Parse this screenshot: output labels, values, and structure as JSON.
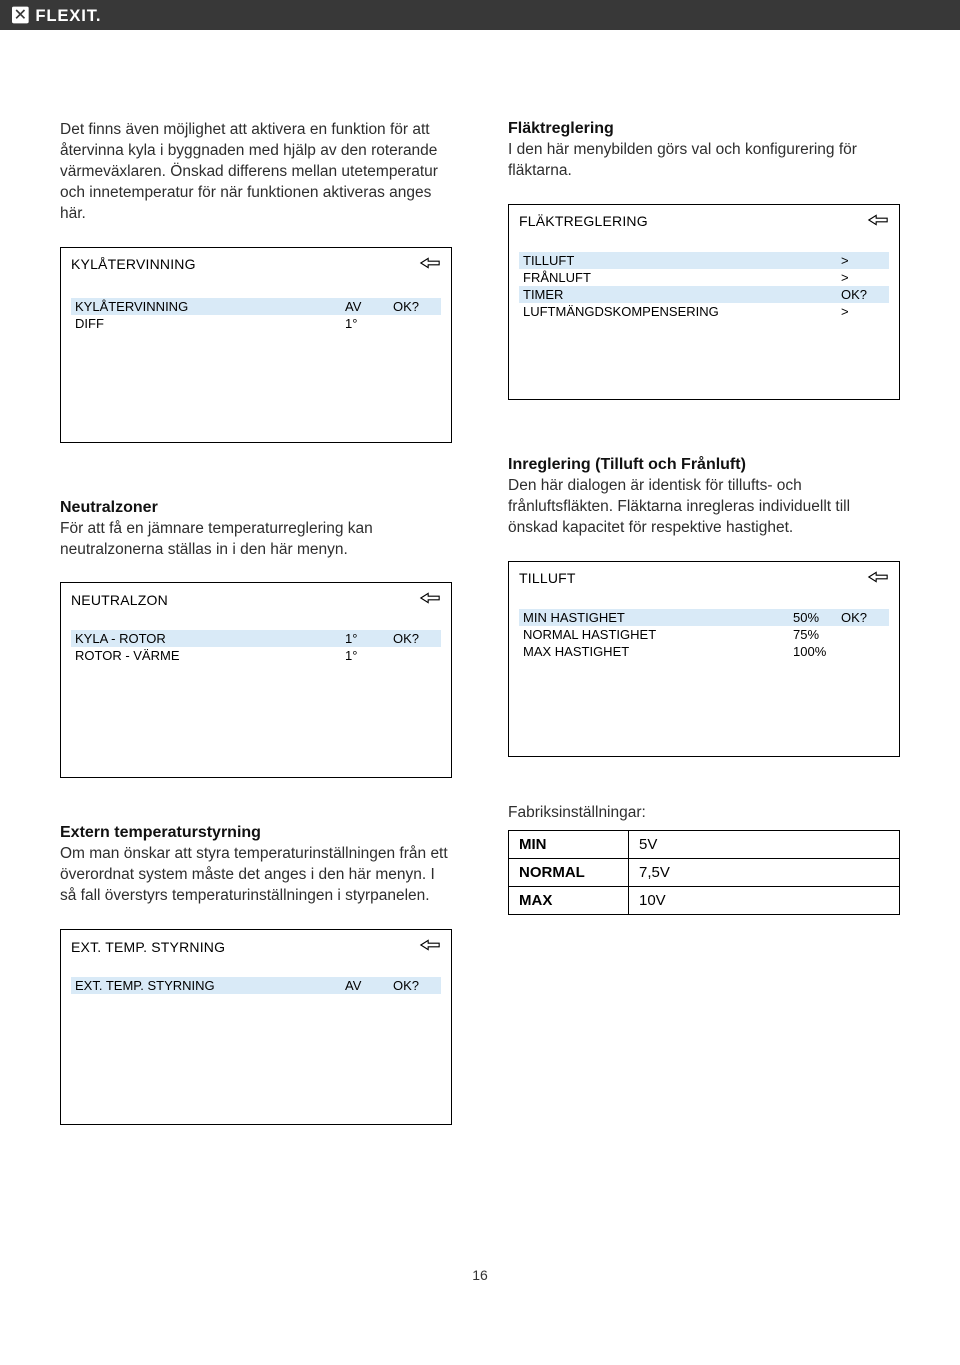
{
  "brand": "FLEXIT.",
  "page_number": "16",
  "left": {
    "intro": "Det finns även möjlighet att aktivera en funktion för att återvinna kyla i byggnaden med hjälp av den roterande värmeväxlaren. Önskad differens mellan utetemperatur och innetemperatur för när funktionen aktiveras anges här.",
    "panel1": {
      "title": "KYLÅTERVINNING",
      "rows": [
        {
          "label": "KYLÅTERVINNING",
          "val": "AV",
          "ok": "OK?",
          "hi": true
        },
        {
          "label": "DIFF",
          "val": "1°",
          "ok": "",
          "hi": false
        }
      ]
    },
    "neutral_h": "Neutralzoner",
    "neutral_p": "För att få en jämnare temperaturreglering kan neutralzonerna ställas in i den här menyn.",
    "panel2": {
      "title": "NEUTRALZON",
      "rows": [
        {
          "label": "KYLA - ROTOR",
          "val": "1°",
          "ok": "OK?",
          "hi": true
        },
        {
          "label": "ROTOR - VÄRME",
          "val": "1°",
          "ok": "",
          "hi": false
        }
      ]
    },
    "ext_h": "Extern temperaturstyrning",
    "ext_p": "Om man önskar att styra temperaturinställningen från ett överordnat system måste det anges i den här menyn. I så fall överstyrs temperaturinställningen i styrpanelen.",
    "panel3": {
      "title": "EXT. TEMP. STYRNING",
      "rows": [
        {
          "label": "EXT. TEMP. STYRNING",
          "val": "AV",
          "ok": "OK?",
          "hi": true
        }
      ]
    }
  },
  "right": {
    "flakt_h": "Fläktreglering",
    "flakt_p": "I den här menybilden görs val och konfigurering för fläktarna.",
    "panel1": {
      "title": "FLÄKTREGLERING",
      "rows": [
        {
          "label": "TILLUFT",
          "val": ">",
          "hi": true
        },
        {
          "label": "FRÅNLUFT",
          "val": ">",
          "hi": false
        },
        {
          "label": "TIMER",
          "val": "OK?",
          "hi": true
        },
        {
          "label": "LUFTMÄNGDSKOMPENSERING",
          "val": ">",
          "hi": false
        }
      ]
    },
    "inreg_h": "Inreglering (Tilluft och Frånluft)",
    "inreg_p": "Den här dialogen är identisk för tillufts- och frånluftsfläkten. Fläktarna inregleras individuellt till önskad kapacitet för respektive hastighet.",
    "panel2": {
      "title": "TILLUFT",
      "rows": [
        {
          "label": "MIN HASTIGHET",
          "val": "50%",
          "ok": "OK?",
          "hi": true
        },
        {
          "label": "NORMAL HASTIGHET",
          "val": "75%",
          "ok": "",
          "hi": false
        },
        {
          "label": "MAX HASTIGHET",
          "val": "100%",
          "ok": "",
          "hi": false
        }
      ]
    },
    "fabrik_label": "Fabriksinställningar:",
    "fabrik": [
      {
        "k": "MIN",
        "v": "5V"
      },
      {
        "k": "NORMAL",
        "v": "7,5V"
      },
      {
        "k": "MAX",
        "v": "10V"
      }
    ]
  }
}
